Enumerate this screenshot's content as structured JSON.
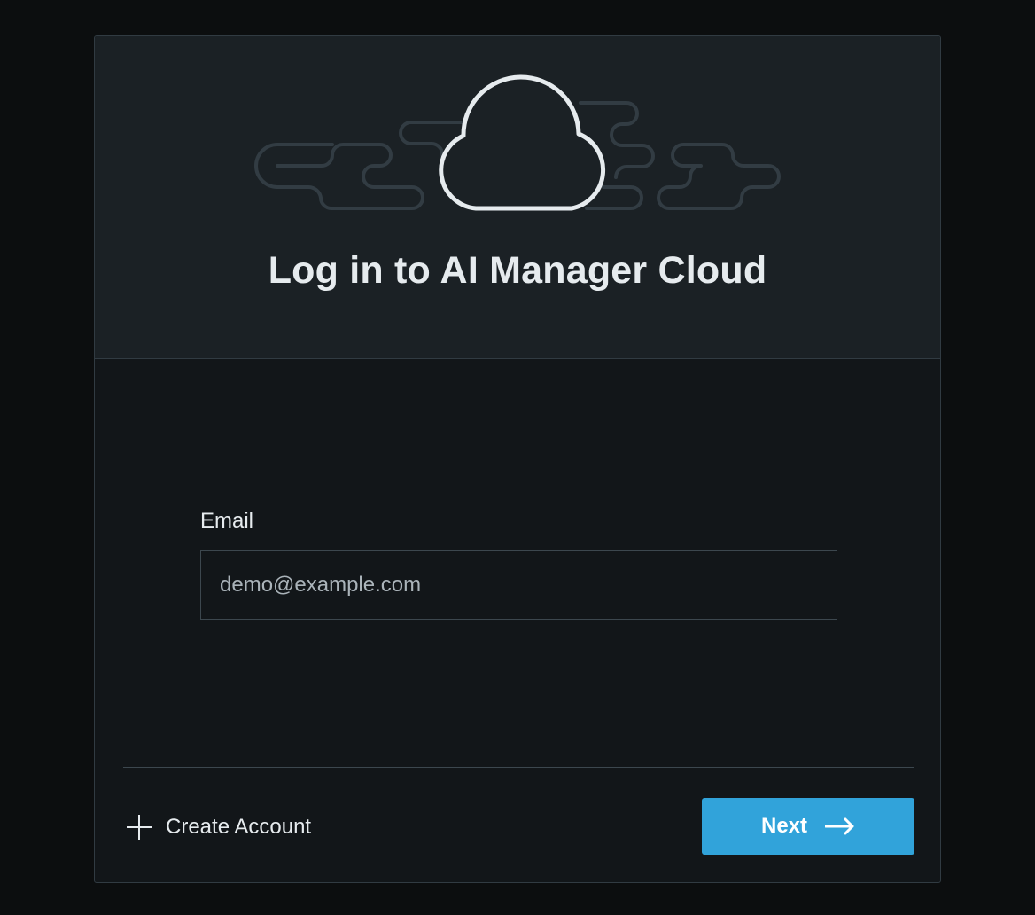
{
  "header": {
    "title": "Log in to AI Manager Cloud",
    "hero_icon": "cloud-icon"
  },
  "form": {
    "email_label": "Email",
    "email_value": "",
    "email_placeholder": "demo@example.com"
  },
  "footer": {
    "create_account_label": "Create Account",
    "create_account_icon": "plus-icon",
    "next_label": "Next",
    "next_icon": "arrow-right-icon"
  },
  "colors": {
    "page_background": "#0c0e0f",
    "header_background": "#1b2125",
    "card_background": "#121619",
    "accent": "#31a3da",
    "text": "#e6ebee"
  }
}
